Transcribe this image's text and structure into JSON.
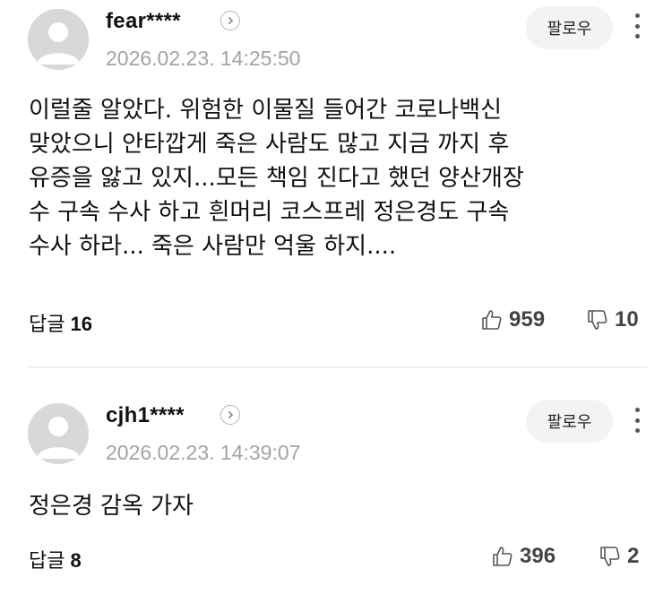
{
  "comments": [
    {
      "nickname": "fear****",
      "date": "2026.02.23. 14:25:50",
      "follow_label": "팔로우",
      "body": "이럴줄 알았다. 위험한 이물질 들어간 코로나백신\n맞았으니 안타깝게 죽은 사람도 많고 지금 까지 후\n유증을 앓고 있지...모든 책임 진다고 했던 양산개장\n수 구속 수사 하고 흰머리 코스프레 정은경도 구속\n수사 하라... 죽은 사람만 억울 하지....",
      "reply_label": "답글",
      "reply_count": "16",
      "likes": "959",
      "dislikes": "10"
    },
    {
      "nickname": "cjh1****",
      "date": "2026.02.23. 14:39:07",
      "follow_label": "팔로우",
      "body": "정은경 감옥 가자",
      "reply_label": "답글",
      "reply_count": "8",
      "likes": "396",
      "dislikes": "2"
    }
  ],
  "icons": {
    "avatar": "default-avatar-icon",
    "chevron": "chevron-right-icon",
    "more": "more-vertical-icon",
    "like": "thumbs-up-icon",
    "dislike": "thumbs-down-icon"
  },
  "colors": {
    "date": "#a3a3a3",
    "follow_bg": "#f3f3f5",
    "avatar_bg": "#d8d8d8",
    "divider": "#eeeeee"
  }
}
